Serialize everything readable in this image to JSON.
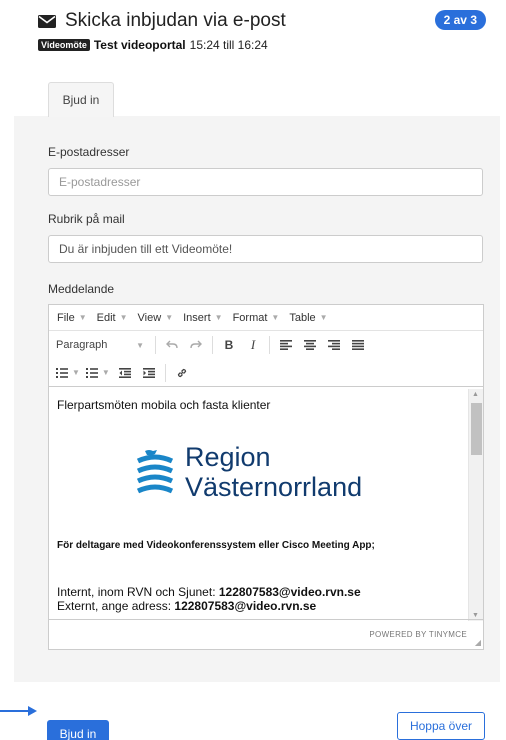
{
  "header": {
    "title": "Skicka inbjudan via e-post",
    "step": "2 av 3",
    "meeting_type": "Videomöte",
    "meeting_title": "Test videoportal",
    "time": "15:24 till 16:24",
    "envelope_icon": "envelope-icon"
  },
  "tabs": [
    {
      "label": "Bjud in",
      "active": true
    }
  ],
  "form": {
    "email_label": "E-postadresser",
    "email_placeholder": "E-postadresser",
    "email_value": "",
    "subject_label": "Rubrik på mail",
    "subject_value": "Du är inbjuden till ett Videomöte!",
    "message_label": "Meddelande"
  },
  "editor": {
    "menu": [
      "File",
      "Edit",
      "View",
      "Insert",
      "Format",
      "Table"
    ],
    "paragraph_select": "Paragraph",
    "content": {
      "line1": "Flerpartsmöten mobila och fasta klienter",
      "logo_line1": "Region",
      "logo_line2": "Västernorrland",
      "bold_line": "För deltagare med Videokonferenssystem eller Cisco Meeting App;",
      "internal_label": "Internt, inom RVN och Sjunet: ",
      "internal_address": "122807583@video.rvn.se",
      "external_label": "Externt, ange adress: ",
      "external_address": "122807583@video.rvn.se"
    },
    "powered_by": "POWERED BY TINYMCE"
  },
  "actions": {
    "invite_label": "Bjud in",
    "skip_label": "Hoppa över"
  },
  "colors": {
    "accent": "#2a6fdb",
    "panel": "#f4f4f4",
    "logo": "#1a86c8"
  }
}
